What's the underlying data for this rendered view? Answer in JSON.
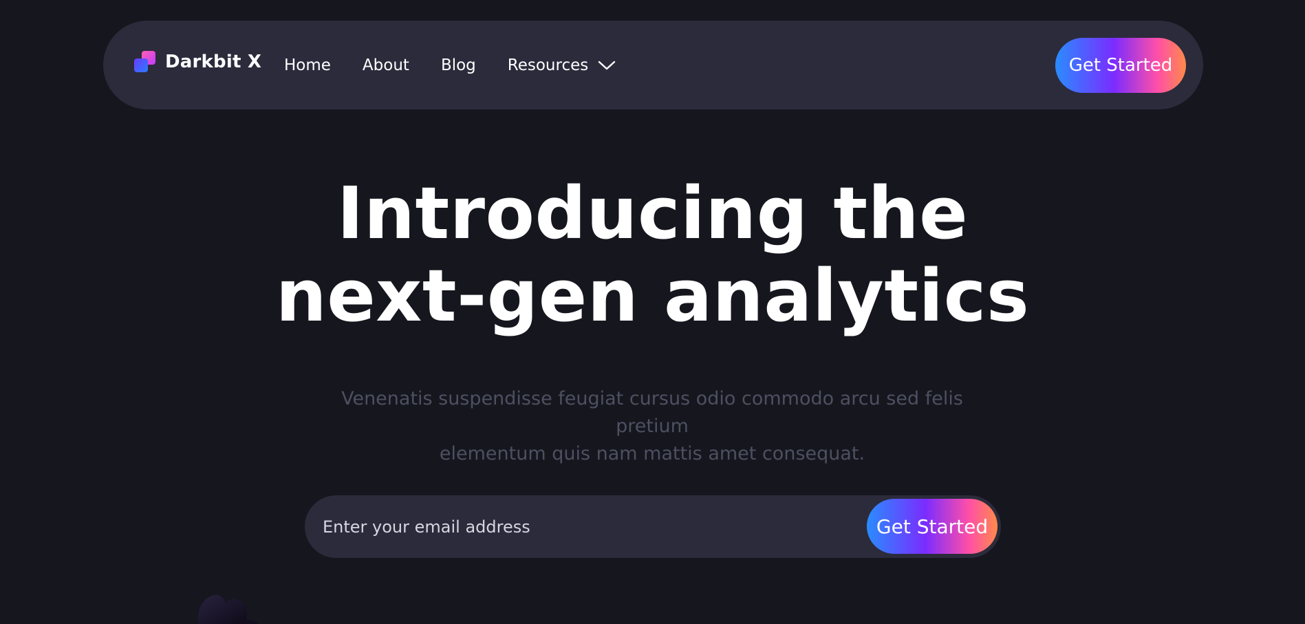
{
  "brand": {
    "name": "Darkbit X",
    "logo_icon": "logo-squares-icon"
  },
  "nav": {
    "links": [
      {
        "label": "Home"
      },
      {
        "label": "About"
      },
      {
        "label": "Blog"
      },
      {
        "label": "Resources",
        "icon": "chevron-down-icon"
      }
    ],
    "cta_label": "Get Started"
  },
  "hero": {
    "title_line1": "Introducing the",
    "title_line2": "next-gen analytics",
    "subtitle_line1": "Venenatis suspendisse feugiat cursus odio commodo arcu sed felis pretium",
    "subtitle_line2": "elementum quis nam mattis amet consequat."
  },
  "email_form": {
    "placeholder": "Enter your email address",
    "value": "",
    "submit_label": "Get Started"
  },
  "colors": {
    "background": "#16161e",
    "surface": "#2c2b3c",
    "text": "#ffffff",
    "muted_text": "#4c5061",
    "gradient": [
      "#2a8cff",
      "#7b2cff",
      "#ff4fa8",
      "#ff8a4a"
    ]
  }
}
